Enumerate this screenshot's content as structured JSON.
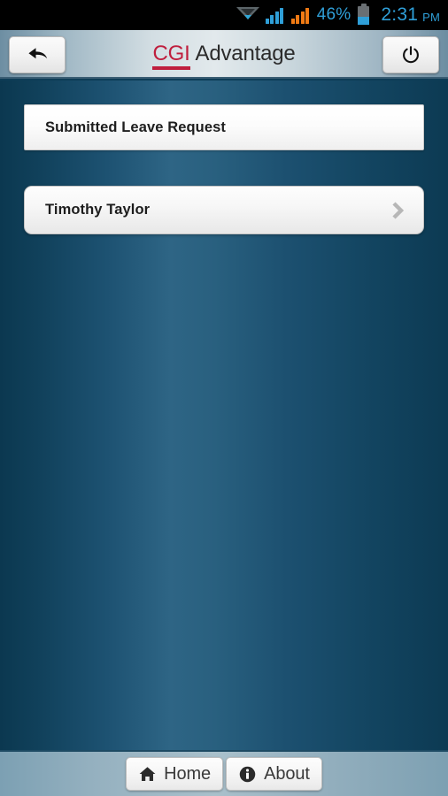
{
  "status_bar": {
    "wifi_icon": "wifi-icon",
    "signal_icon_1": "signal-bars-icon",
    "signal_icon_2": "signal-bars-icon",
    "battery_percent": "46%",
    "battery_icon": "battery-icon",
    "time": "2:31",
    "ampm": "PM",
    "colors": {
      "background": "#000000",
      "accent": "#2f9fd8",
      "signal_secondary": "#f07a14"
    }
  },
  "header": {
    "back_button": {
      "name": "back-button",
      "icon": "back-arrow-icon"
    },
    "power_button": {
      "name": "power-button",
      "icon": "power-icon"
    },
    "brand": {
      "primary": "CGI",
      "secondary": "Advantage",
      "primary_color": "#bf1e3d"
    }
  },
  "main": {
    "section_header": "Submitted Leave Request",
    "rows": [
      {
        "label": "Timothy Taylor",
        "accessory_icon": "chevron-right-icon"
      }
    ],
    "background_colors": {
      "dark": "#0b3850",
      "light": "#2e6585"
    }
  },
  "bottom_toolbar": {
    "buttons": [
      {
        "label": "Home",
        "icon": "home-icon"
      },
      {
        "label": "About",
        "icon": "info-icon"
      }
    ]
  }
}
